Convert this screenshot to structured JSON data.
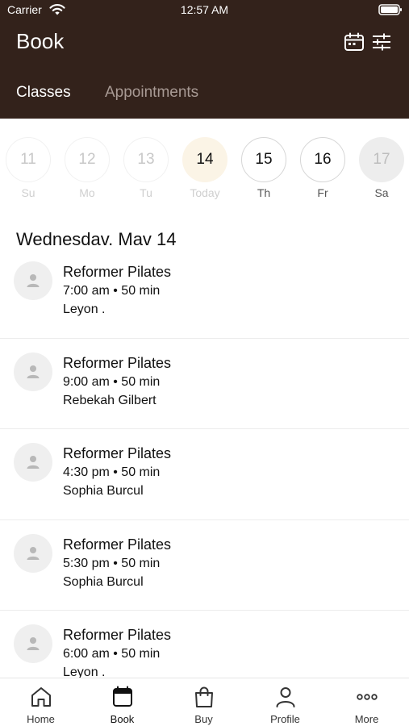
{
  "status_bar": {
    "carrier": "Carrier",
    "time": "12:57 AM"
  },
  "header": {
    "title": "Book",
    "tabs": [
      {
        "label": "Classes",
        "active": true
      },
      {
        "label": "Appointments",
        "active": false
      }
    ],
    "colors": {
      "background": "#33221b",
      "inactive_tab": "#a89a94"
    }
  },
  "week": [
    {
      "number": "11",
      "label": "Su",
      "state": "past"
    },
    {
      "number": "12",
      "label": "Mo",
      "state": "past"
    },
    {
      "number": "13",
      "label": "Tu",
      "state": "past"
    },
    {
      "number": "14",
      "label": "Today",
      "state": "today"
    },
    {
      "number": "15",
      "label": "Th",
      "state": "future"
    },
    {
      "number": "16",
      "label": "Fr",
      "state": "future"
    },
    {
      "number": "17",
      "label": "Sa",
      "state": "disabled"
    }
  ],
  "date_heading": "Wednesdav. Mav 14",
  "classes": [
    {
      "name": "Reformer Pilates",
      "time": "7:00 am • 50 min",
      "instructor": "Leyon ."
    },
    {
      "name": "Reformer Pilates",
      "time": "9:00 am • 50 min",
      "instructor": "Rebekah Gilbert"
    },
    {
      "name": "Reformer Pilates",
      "time": "4:30 pm • 50 min",
      "instructor": "Sophia Burcul"
    },
    {
      "name": "Reformer Pilates",
      "time": "5:30 pm • 50 min",
      "instructor": "Sophia Burcul"
    },
    {
      "name": "Reformer Pilates",
      "time": "6:00 am • 50 min",
      "instructor": "Leyon ."
    }
  ],
  "bottom_nav": [
    {
      "label": "Home",
      "icon": "home-icon"
    },
    {
      "label": "Book",
      "icon": "calendar-icon",
      "active": true
    },
    {
      "label": "Buy",
      "icon": "shopping-bag-icon"
    },
    {
      "label": "Profile",
      "icon": "profile-icon"
    },
    {
      "label": "More",
      "icon": "more-icon"
    }
  ]
}
